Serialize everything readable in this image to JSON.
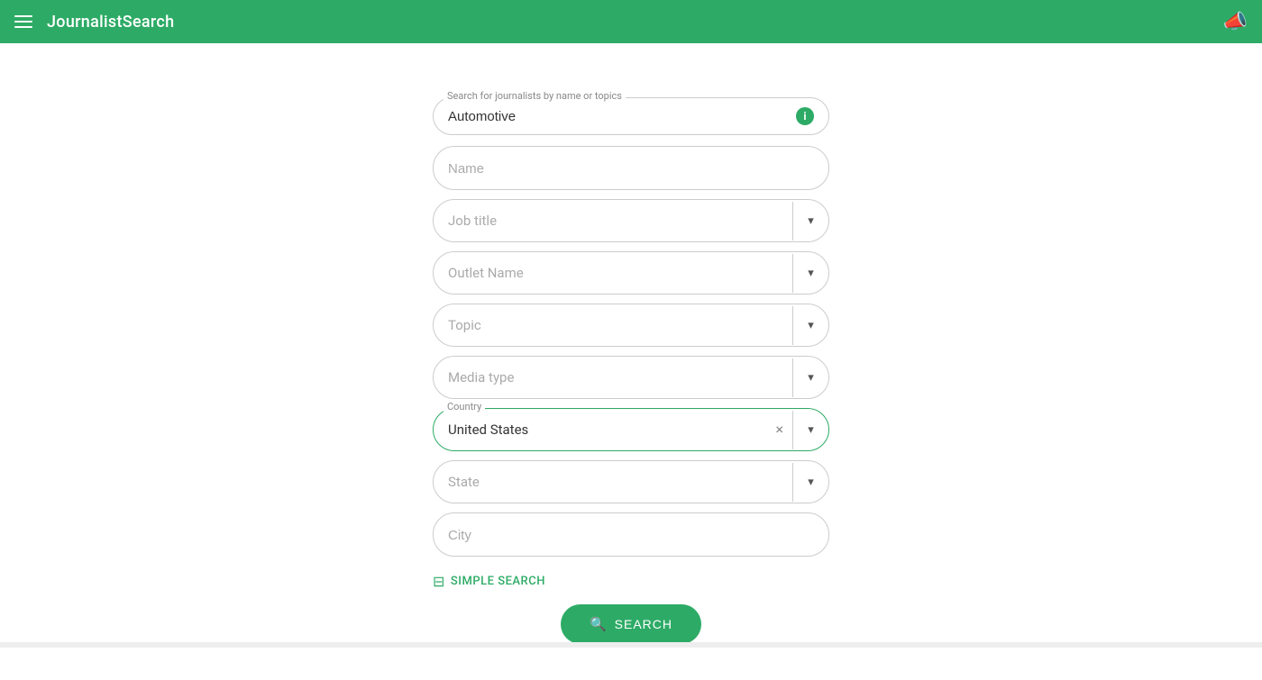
{
  "header": {
    "title": "JournalistSearch",
    "menu_icon": "≡",
    "megaphone_icon": "📣"
  },
  "form": {
    "search_label": "Search for journalists by name or topics",
    "search_value": "Automotive",
    "search_placeholder": "Search for journalists by name or topics",
    "info_icon": "i",
    "name_placeholder": "Name",
    "job_title_placeholder": "Job title",
    "outlet_name_placeholder": "Outlet Name",
    "topic_placeholder": "Topic",
    "media_type_placeholder": "Media type",
    "country_label": "Country",
    "country_value": "United States",
    "country_clear": "×",
    "state_placeholder": "State",
    "city_placeholder": "City",
    "chevron": "▾",
    "simple_search_label": "SIMPLE SEARCH",
    "search_button_label": "SEARCH",
    "search_icon": "🔍"
  }
}
